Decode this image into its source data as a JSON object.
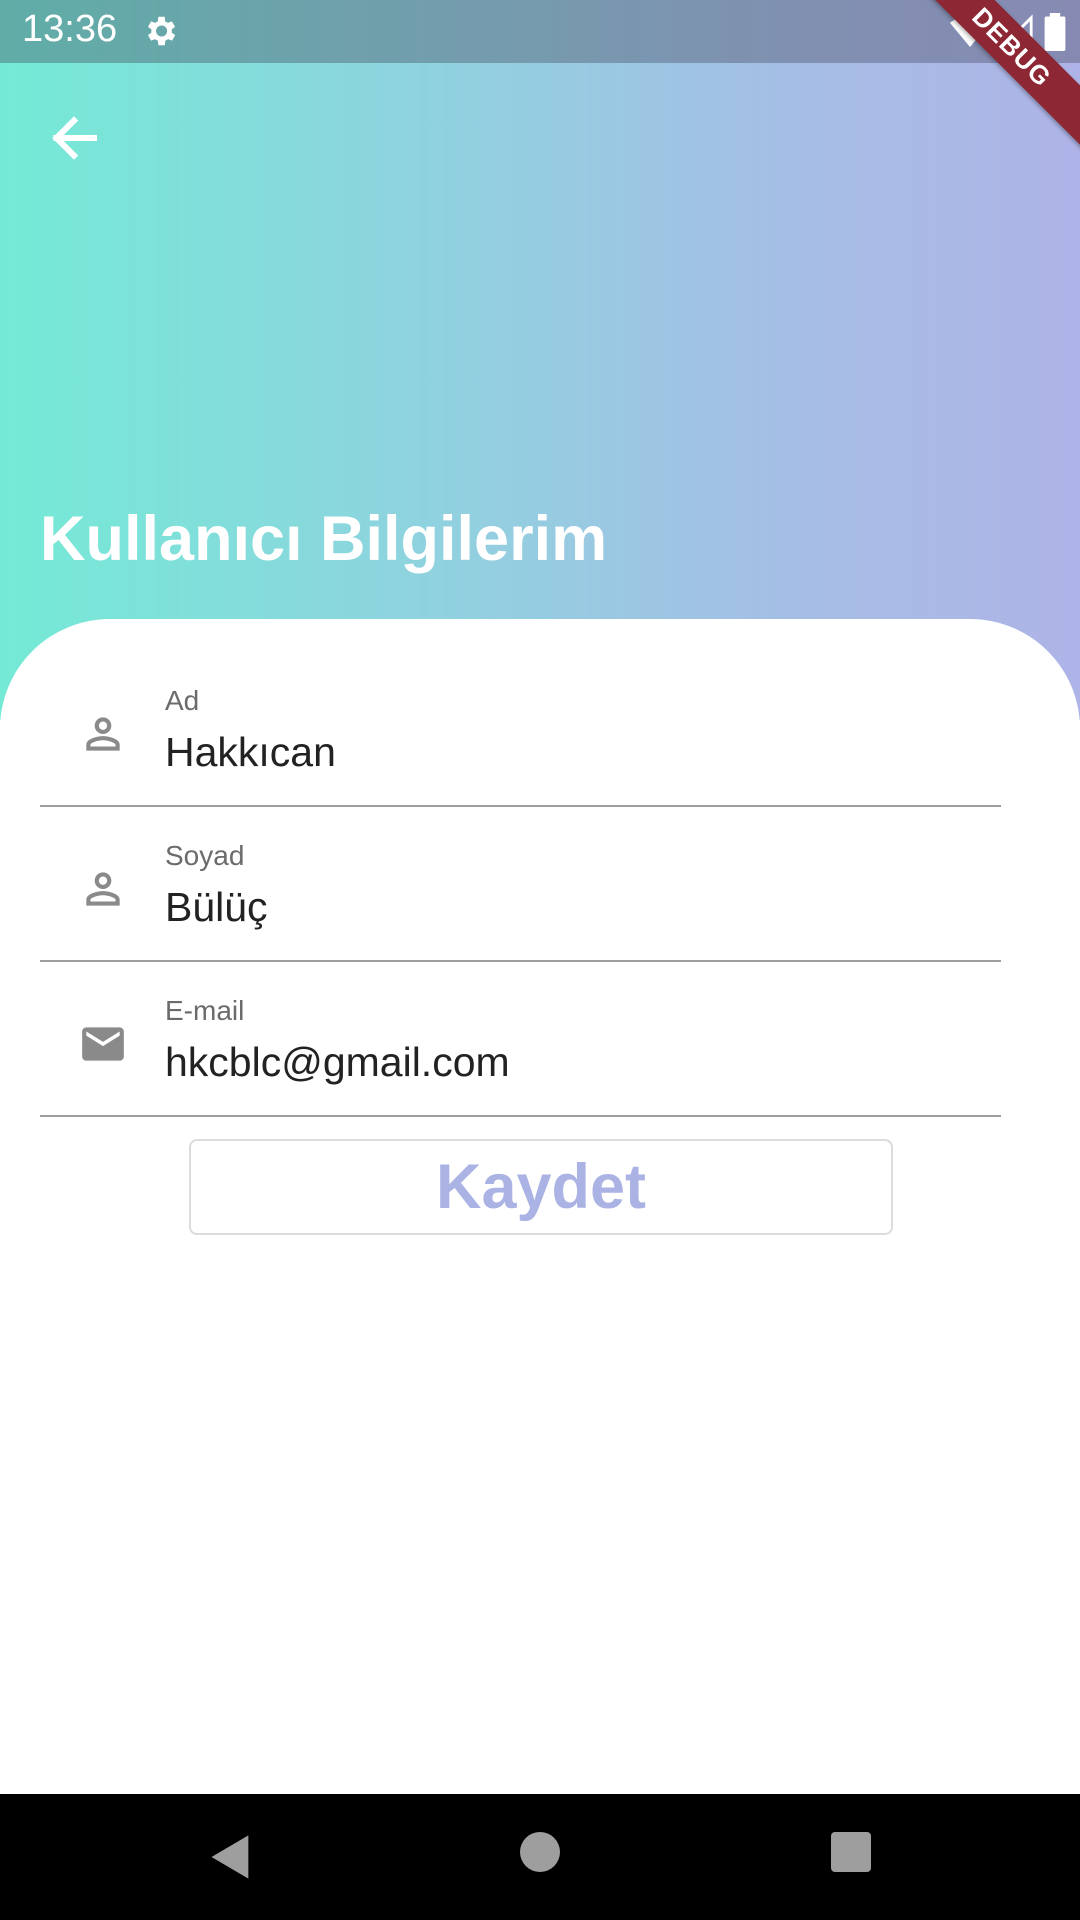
{
  "status_bar": {
    "time": "13:36",
    "icons": [
      "gear-icon",
      "wifi-icon",
      "signal-icon",
      "battery-icon"
    ],
    "debug_label": "DEBUG"
  },
  "header": {
    "title": "Kullanıcı Bilgilerim",
    "back_icon": "arrow-left-icon",
    "gradient": [
      "#74ead6",
      "#aeb4e7"
    ]
  },
  "form": {
    "fields": [
      {
        "label": "Ad",
        "value": "Hakkıcan",
        "icon": "person-outline-icon"
      },
      {
        "label": "Soyad",
        "value": "Bülüç",
        "icon": "person-outline-icon"
      },
      {
        "label": "E-mail",
        "value": "hkcblc@gmail.com",
        "icon": "mail-icon"
      }
    ],
    "save_label": "Kaydet",
    "accent": "#aab3e4"
  },
  "nav_bar": {
    "icons": [
      "nav-back-icon",
      "nav-home-icon",
      "nav-recents-icon"
    ]
  }
}
